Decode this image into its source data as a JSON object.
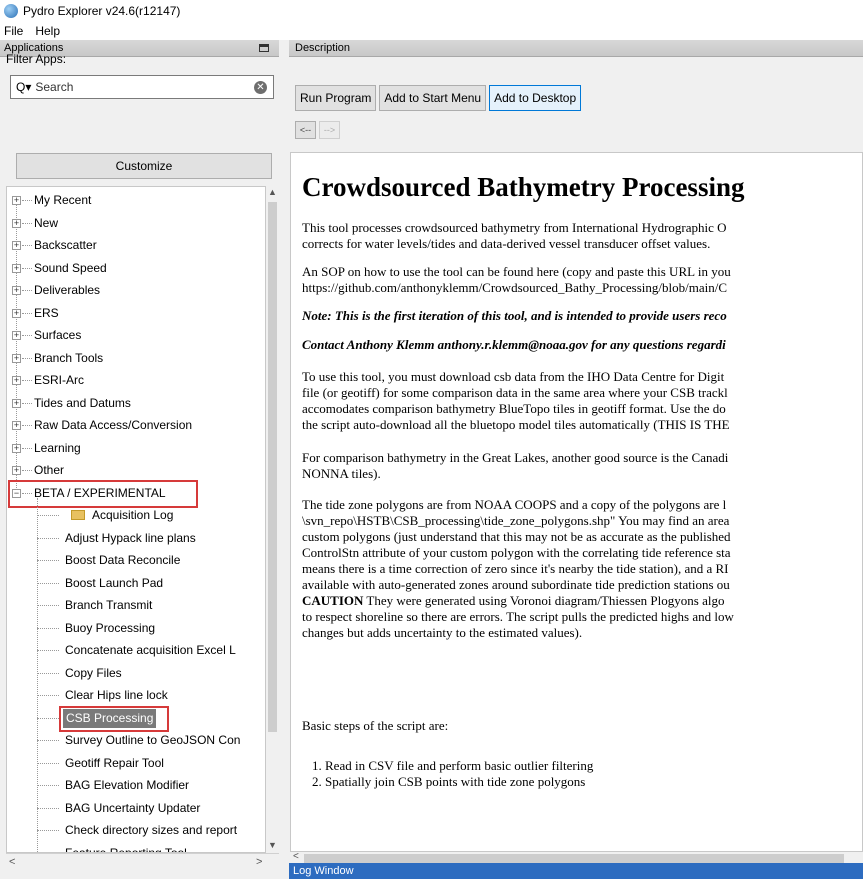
{
  "window": {
    "title": "Pydro Explorer v24.6(r12147)",
    "app_icon": "pydro-globe-icon"
  },
  "menu": [
    "File",
    "Help"
  ],
  "left_panel": {
    "title": "Applications",
    "filter_label": "Filter Apps:",
    "search": {
      "placeholder": "Search",
      "prefix_glyph": "Q▾"
    },
    "customize_label": "Customize",
    "categories": [
      "My Recent",
      "New",
      "Backscatter",
      "Sound Speed",
      "Deliverables",
      "ERS",
      "Surfaces",
      "Branch Tools",
      "ESRI-Arc",
      "Tides and Datums",
      "Raw Data Access/Conversion",
      "Learning",
      "Other"
    ],
    "expanded_category": "BETA / EXPERIMENTAL",
    "children": [
      "Acquisition Log",
      "Adjust Hypack line plans",
      "Boost Data Reconcile",
      "Boost Launch Pad",
      "Branch Transmit",
      "Buoy Processing",
      "Concatenate acquisition Excel L",
      "Copy Files",
      "Clear Hips line lock",
      "CSB Processing",
      "Survey Outline to GeoJSON Con",
      "Geotiff Repair Tool",
      "BAG Elevation Modifier",
      "BAG Uncertainty Updater",
      "Check directory sizes and report",
      "Feature Reporting Tool"
    ],
    "selected_child": "CSB Processing"
  },
  "right_panel": {
    "title": "Description",
    "buttons": [
      "Run Program",
      "Add to Start Menu",
      "Add to Desktop"
    ],
    "nav": {
      "back": "<--",
      "forward": "-->"
    },
    "doc": {
      "heading": "Crowdsourced Bathymetry Processing",
      "p1": [
        "This tool processes crowdsourced bathymetry from International Hydrographic O",
        "corrects for water levels/tides and data-derived vessel transducer offset values."
      ],
      "p2": [
        "An SOP on how to use the tool can be found here (copy and paste this URL in you",
        "https://github.com/anthonyklemm/Crowdsourced_Bathy_Processing/blob/main/C"
      ],
      "note": "Note: This is the first iteration of this tool, and is intended to provide users reco",
      "contact": "Contact Anthony Klemm anthony.r.klemm@noaa.gov for any questions regardi",
      "p3": [
        "To use this tool, you must download csb data from the IHO Data Centre for Digit",
        "file (or geotiff) for some comparison data in the same area where your CSB trackl",
        "accomodates comparison bathymetry BlueTopo tiles in geotiff format. Use the do",
        "the script auto-download all the bluetopo model tiles automatically (THIS IS THE"
      ],
      "p4": [
        "For comparison bathymetry in the Great Lakes, another good source is the Canadi",
        "NONNA tiles)."
      ],
      "p5": [
        "The tide zone polygons are from NOAA COOPS and a copy of the polygons are l",
        "\\svn_repo\\HSTB\\CSB_processing\\tide_zone_polygons.shp\" You may find an area",
        "custom polygons (just understand that this may not be as accurate as the published",
        "ControlStn attribute of your custom polygon with the correlating tide reference sta",
        "means there is a time correction of zero since it's nearby the tide station), and a RI",
        "available with auto-generated zones around subordinate tide prediction stations ou"
      ],
      "caution_word": "CAUTION",
      "caution_rest": " They were generated using Voronoi diagram/Thiessen Plogyons algo",
      "p5b": [
        "to respect shoreline so there are errors. The script pulls the predicted highs and low",
        "changes but adds uncertainty to the estimated values)."
      ],
      "steps_intro": "Basic steps of the script are:",
      "steps": [
        "Read in CSV file and perform basic outlier filtering",
        "Spatially join CSB points with tide zone polygons"
      ]
    }
  },
  "log_window": {
    "title": "Log Window"
  },
  "colors": {
    "highlight": "#d63a3a",
    "selected_bg": "#7a7a7a",
    "log_bar": "#2d6cc0",
    "focus_border": "#0078d7"
  }
}
